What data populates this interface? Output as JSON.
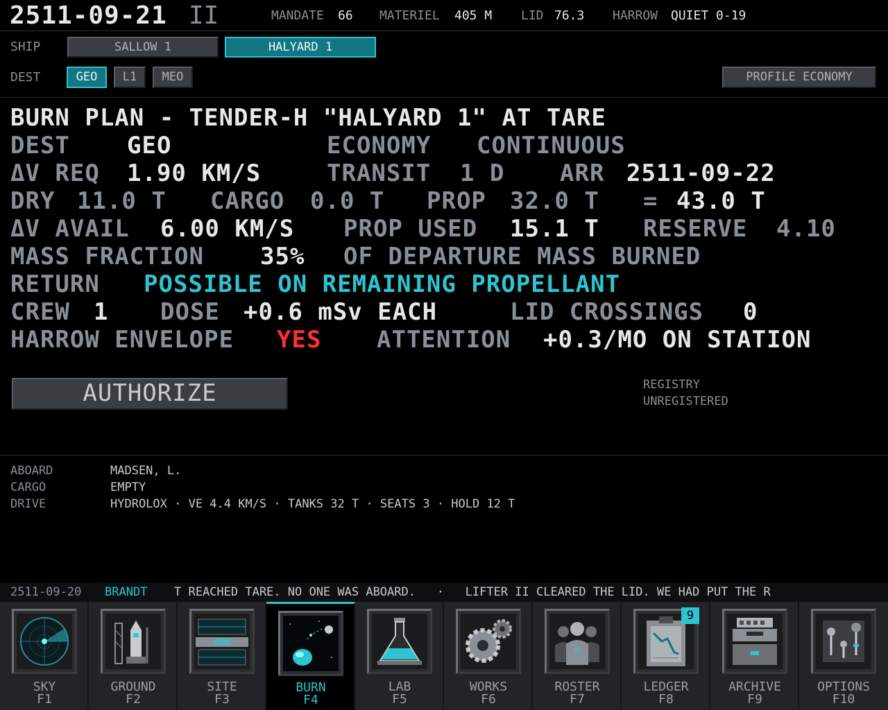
{
  "header": {
    "date": "2511-09-21",
    "era": "II",
    "stats": [
      {
        "label": "MANDATE",
        "value": "66"
      },
      {
        "label": "MATERIEL",
        "value": "405 M"
      },
      {
        "label": "LID",
        "value": "76.3"
      },
      {
        "label": "HARROW",
        "value": "QUIET 0-19"
      }
    ]
  },
  "ship_select": {
    "label": "SHIP",
    "options": [
      "SALLOW 1",
      "HALYARD 1"
    ],
    "selected": "HALYARD 1"
  },
  "dest_select": {
    "label": "DEST",
    "options": [
      "GEO",
      "L1",
      "MEO"
    ],
    "selected": "GEO"
  },
  "profile_button": "PROFILE ECONOMY",
  "plan": {
    "title": "BURN PLAN - TENDER-H \"HALYARD 1\" AT TARE",
    "dest_label": "DEST",
    "dest_value": "GEO",
    "profile_value": "ECONOMY",
    "mode_value": "CONTINUOUS",
    "dv_req_label": "ΔV REQ",
    "dv_req_value": "1.90 KM/S",
    "transit_label": "TRANSIT",
    "transit_value": "1 D",
    "arr_label": "ARR",
    "arr_value": "2511-09-22",
    "dry_label": "DRY",
    "dry_value": "11.0 T",
    "cargo_label": "CARGO",
    "cargo_value": "0.0 T",
    "prop_label": "PROP",
    "prop_value": "32.0 T",
    "total_label": "=",
    "total_value": "43.0 T",
    "dv_avail_label": "ΔV AVAIL",
    "dv_avail_value": "6.00 KM/S",
    "prop_used_label": "PROP USED",
    "prop_used_value": "15.1 T",
    "reserve_label": "RESERVE",
    "reserve_value": "4.10",
    "mass_fraction_label": "MASS FRACTION",
    "mass_fraction_value": "35%",
    "mass_fraction_suffix": "OF DEPARTURE MASS BURNED",
    "return_label": "RETURN",
    "return_value": "POSSIBLE ON REMAINING PROPELLANT",
    "crew_label": "CREW",
    "crew_value": "1",
    "dose_label": "DOSE",
    "dose_value": "+0.6 mSv EACH",
    "lid_label": "LID CROSSINGS",
    "lid_value": "0",
    "harrow_label": "HARROW ENVELOPE",
    "harrow_value": "YES",
    "attention_label": "ATTENTION",
    "attention_value": "+0.3/MO ON STATION"
  },
  "authorize_button": "AUTHORIZE",
  "registry": {
    "label": "REGISTRY",
    "value": "UNREGISTERED"
  },
  "ship_info": [
    {
      "label": "ABOARD",
      "value": "MADSEN, L."
    },
    {
      "label": "CARGO",
      "value": "EMPTY"
    },
    {
      "label": "DRIVE",
      "value": "HYDROLOX · VE 4.4 KM/S · TANKS 32 T · SEATS 3 · HOLD 12 T"
    }
  ],
  "ticker": {
    "date": "2511-09-20",
    "name": "BRANDT",
    "text": "T REACHED TARE. NO ONE WAS ABOARD.   ·   LIFTER II CLEARED THE LID. WE HAD PUT THE R"
  },
  "dock": [
    {
      "label": "SKY",
      "key": "F1",
      "icon": "radar-icon"
    },
    {
      "label": "GROUND",
      "key": "F2",
      "icon": "launch-tower-icon"
    },
    {
      "label": "SITE",
      "key": "F3",
      "icon": "station-icon"
    },
    {
      "label": "BURN",
      "key": "F4",
      "icon": "orbit-burn-icon"
    },
    {
      "label": "LAB",
      "key": "F5",
      "icon": "flask-icon"
    },
    {
      "label": "WORKS",
      "key": "F6",
      "icon": "gears-icon"
    },
    {
      "label": "ROSTER",
      "key": "F7",
      "icon": "crew-icon"
    },
    {
      "label": "LEDGER",
      "key": "F8",
      "icon": "clipboard-chart-icon",
      "badge": "9"
    },
    {
      "label": "ARCHIVE",
      "key": "F9",
      "icon": "archive-icon"
    },
    {
      "label": "OPTIONS",
      "key": "F10",
      "icon": "levers-icon"
    }
  ],
  "active_tab": "BURN",
  "colors": {
    "accent": "#2ec4d0",
    "alert": "#ff3030",
    "background": "#000000"
  }
}
